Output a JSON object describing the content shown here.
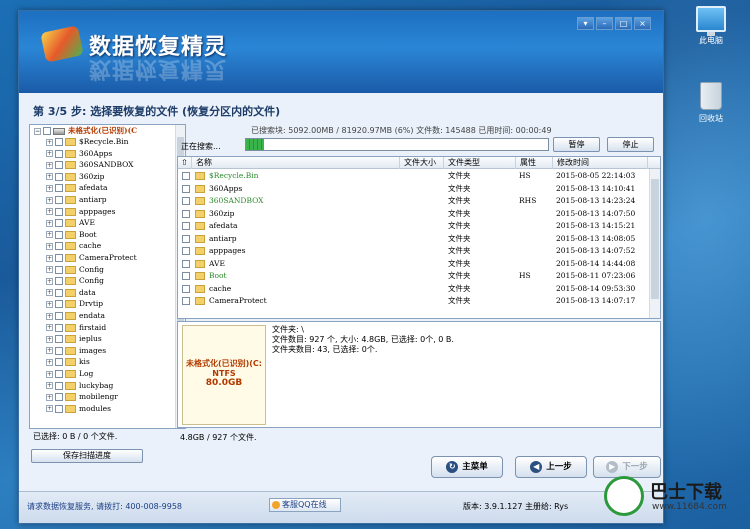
{
  "desktop": {
    "icons": [
      {
        "label": "此电脑"
      },
      {
        "label": "回收站"
      }
    ]
  },
  "window": {
    "title": "数据恢复精灵",
    "controls": [
      "▾",
      "–",
      "□",
      "×"
    ]
  },
  "step": {
    "title": "第 3/5 步: 选择要恢复的文件 (恢复分区内的文件)"
  },
  "tree": {
    "root": "未格式化(已识别)(C",
    "items": [
      "$Recycle.Bin",
      "360Apps",
      "360SANDBOX",
      "360zip",
      "afedata",
      "antiarp",
      "apppages",
      "AVE",
      "Boot",
      "cache",
      "CameraProtect",
      "Config",
      "Config",
      "data",
      "Drvtip",
      "endata",
      "firstaid",
      "ieplus",
      "images",
      "kis",
      "Log",
      "luckybag",
      "mobilengr",
      "modules"
    ]
  },
  "scan": {
    "stats": "已搜索块: 5092.00MB / 81920.97MB (6%) 文件数: 145488 已用时间: 00:00:49",
    "label": "正在搜索...",
    "progress_pct": 6,
    "pause": "暂停",
    "stop": "停止"
  },
  "grid": {
    "columns": [
      "名称",
      "文件大小",
      "文件类型",
      "属性",
      "修改时间"
    ],
    "rows": [
      {
        "name": "$Recycle.Bin",
        "type": "文件夹",
        "attr": "HS",
        "time": "2015-08-05 22:14:03",
        "color": "#2a8a2a"
      },
      {
        "name": "360Apps",
        "type": "文件夹",
        "attr": "",
        "time": "2015-08-13 14:10:41",
        "color": "#000000"
      },
      {
        "name": "360SANDBOX",
        "type": "文件夹",
        "attr": "RHS",
        "time": "2015-08-13 14:23:24",
        "color": "#2a8a2a"
      },
      {
        "name": "360zip",
        "type": "文件夹",
        "attr": "",
        "time": "2015-08-13 14:07:50",
        "color": "#000000"
      },
      {
        "name": "afedata",
        "type": "文件夹",
        "attr": "",
        "time": "2015-08-13 14:15:21",
        "color": "#000000"
      },
      {
        "name": "antiarp",
        "type": "文件夹",
        "attr": "",
        "time": "2015-08-13 14:08:05",
        "color": "#000000"
      },
      {
        "name": "apppages",
        "type": "文件夹",
        "attr": "",
        "time": "2015-08-13 14:07:52",
        "color": "#000000"
      },
      {
        "name": "AVE",
        "type": "文件夹",
        "attr": "",
        "time": "2015-08-14 14:44:08",
        "color": "#000000"
      },
      {
        "name": "Boot",
        "type": "文件夹",
        "attr": "HS",
        "time": "2015-08-11 07:23:06",
        "color": "#2a8a2a"
      },
      {
        "name": "cache",
        "type": "文件夹",
        "attr": "",
        "time": "2015-08-14 09:53:30",
        "color": "#000000"
      },
      {
        "name": "CameraProtect",
        "type": "文件夹",
        "attr": "",
        "time": "2015-08-13 14:07:17",
        "color": "#000000"
      }
    ]
  },
  "info": {
    "disk_name": "未格式化(已识别)(C:",
    "fs": "NTFS",
    "size": "80.0GB",
    "line1": "文件夹: \\",
    "line2": "文件数目: 927 个, 大小: 4.8GB, 已选择: 0个, 0 B.",
    "line3": "文件夹数目: 43, 已选择: 0个."
  },
  "status": {
    "selected": "已选择: 0 B / 0 个文件.",
    "total": "4.8GB / 927 个文件."
  },
  "buttons": {
    "save_progress": "保存扫描进度",
    "main_menu": "主菜单",
    "prev": "上一步",
    "next": "下一步"
  },
  "footer": {
    "service": "请求数据恢复服务, 请拨打: 400-008-9958",
    "qq": "客服QQ在线",
    "version": "版本: 3.9.1.127 主册给: Rys"
  },
  "watermark": {
    "title": "巴士下载",
    "url": "www.11684.com"
  }
}
